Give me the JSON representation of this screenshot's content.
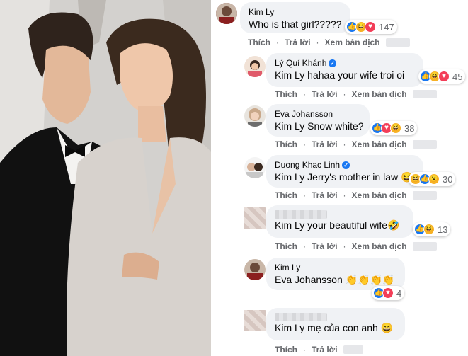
{
  "actions": {
    "like": "Thích",
    "reply": "Trả lời",
    "translate": "Xem bản dịch",
    "dot": "·"
  },
  "reaction_colors": {
    "like": "#1877f2",
    "love": "#f33e58",
    "haha": "#f7b125"
  },
  "comments": [
    {
      "author": "Kim Ly",
      "tag": "",
      "body": "Who is that girl?????",
      "reaction_count": "147",
      "reactions": [
        "like-icon",
        "haha-icon",
        "love-icon"
      ]
    },
    {
      "author": "Lý Quí Khánh",
      "verified": true,
      "tag": "Kim Ly",
      "body": " hahaa your wife troi oi",
      "reaction_count": "45",
      "reactions": [
        "like-icon",
        "haha-icon",
        "love-icon"
      ]
    },
    {
      "author": "Eva Johansson",
      "tag": "Kim Ly",
      "body": " Snow white?",
      "reaction_count": "38",
      "reactions": [
        "like-icon",
        "love-icon",
        "haha-icon"
      ]
    },
    {
      "author": "Duong Khac Linh",
      "verified": true,
      "tag": "Kim Ly",
      "body": " Jerry's mother in law ",
      "trailing_emoji": "😆",
      "reaction_count": "30",
      "reactions": [
        "haha-icon",
        "like-icon",
        "wow-icon"
      ]
    },
    {
      "author": "",
      "tag": "Kim Ly",
      "body": " your beautiful wife",
      "trailing_emoji": "🤣",
      "reaction_count": "13",
      "reactions": [
        "like-icon",
        "haha-icon"
      ]
    },
    {
      "author": "Kim Ly",
      "tag": "",
      "body": "Eva Johansson ",
      "trailing_emoji": "👏👏👏👏",
      "reaction_count": "4",
      "reactions": [
        "like-icon",
        "love-icon"
      ]
    },
    {
      "author": "",
      "tag": "Kim Ly",
      "body": " mẹ của con anh ",
      "trailing_emoji": "😄"
    }
  ]
}
